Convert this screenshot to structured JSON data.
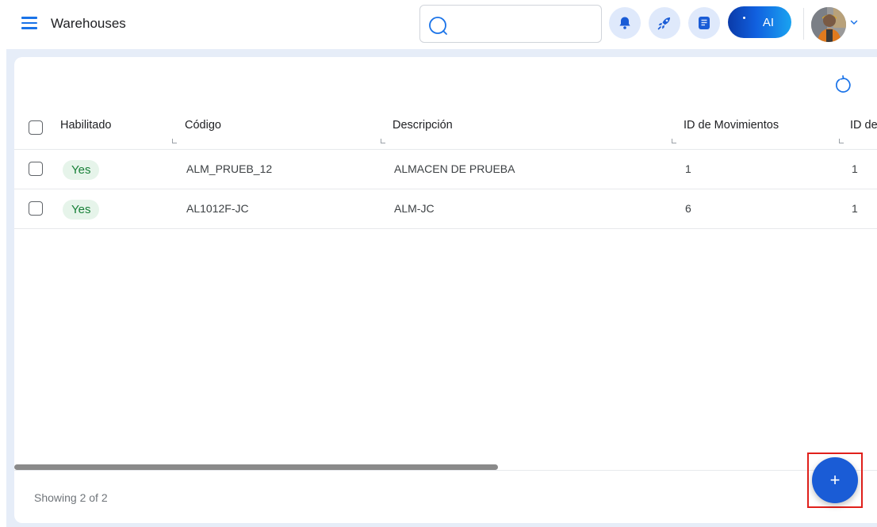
{
  "header": {
    "title": "Warehouses",
    "search": {
      "value": "",
      "placeholder": ""
    },
    "ai_label": "AI",
    "icons": [
      "menu-icon",
      "search-icon",
      "bell-icon",
      "rocket-icon",
      "notes-icon",
      "chevron-down-icon",
      "refresh-icon",
      "plus-icon"
    ]
  },
  "table": {
    "columns": [
      "Habilitado",
      "Código",
      "Descripción",
      "ID de Movimientos",
      "ID de"
    ],
    "rows": [
      {
        "habilitado": "Yes",
        "codigo": "ALM_PRUEB_12",
        "descripcion": "ALMACEN DE PRUEBA",
        "id_movimientos": "1",
        "id_de": "1"
      },
      {
        "habilitado": "Yes",
        "codigo": "AL1012F-JC",
        "descripcion": "ALM-JC",
        "id_movimientos": "6",
        "id_de": "1"
      }
    ]
  },
  "footer": {
    "showing": "Showing 2 of 2"
  },
  "fab": {
    "label": "+"
  },
  "colors": {
    "accent": "#1a73e8",
    "fab": "#1a5cd6",
    "badge_bg": "#e6f4ea",
    "badge_text": "#188038",
    "highlight": "#e0201b"
  }
}
